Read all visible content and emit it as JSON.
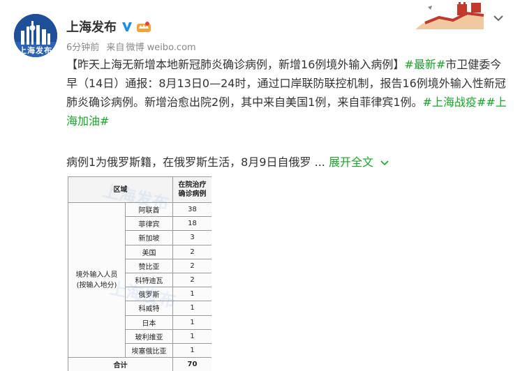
{
  "account": {
    "name": "上海发布",
    "avatar_text": "上海发布",
    "verified_icon": "verified-v-icon",
    "member_icon": "member-crown-icon"
  },
  "meta": {
    "time": "6分钟前",
    "source_prefix": "来自",
    "source": "微博 weibo.com"
  },
  "post": {
    "bracket_open": "【",
    "headline": "昨天上海无新增本地新冠肺炎确诊病例，新增16例境外输入病例",
    "bracket_close": "】",
    "tag_latest": "#最新#",
    "text_main": "市卫健委今早（14日）通报：8月13日0—24时，通过口岸联防联控机制，报告16例境外输入性新冠肺炎确诊病例。新增治愈出院2例，其中来自美国1例，来自菲律宾1例。",
    "tag_fight": "#上海战疫#",
    "tag_cheer": "#上海加油#",
    "excerpt": "病例1为俄罗斯籍，在俄罗斯生活，8月9日自俄罗 ...",
    "expand_label": "展开全文"
  },
  "table": {
    "header_region": "区域",
    "header_count_line1": "在院治疗",
    "header_count_line2": "确诊病例",
    "region_line1": "境外输入人员",
    "region_line2": "(按输入地分)",
    "rows": [
      {
        "country": "阿联酋",
        "count": "38"
      },
      {
        "country": "菲律宾",
        "count": "18"
      },
      {
        "country": "新加坡",
        "count": "3"
      },
      {
        "country": "美国",
        "count": "2"
      },
      {
        "country": "赞比亚",
        "count": "2"
      },
      {
        "country": "科特迪瓦",
        "count": "2"
      },
      {
        "country": "俄罗斯",
        "count": "1"
      },
      {
        "country": "科威特",
        "count": "1"
      },
      {
        "country": "日本",
        "count": "1"
      },
      {
        "country": "玻利维亚",
        "count": "1"
      },
      {
        "country": "埃塞俄比亚",
        "count": "1"
      }
    ],
    "total_label": "合计",
    "total_value": "70",
    "watermark": "上海发布"
  },
  "colors": {
    "hashtag": "#1aa42a",
    "meta_text": "#888888",
    "avatar_bg": "#1f4f97"
  }
}
